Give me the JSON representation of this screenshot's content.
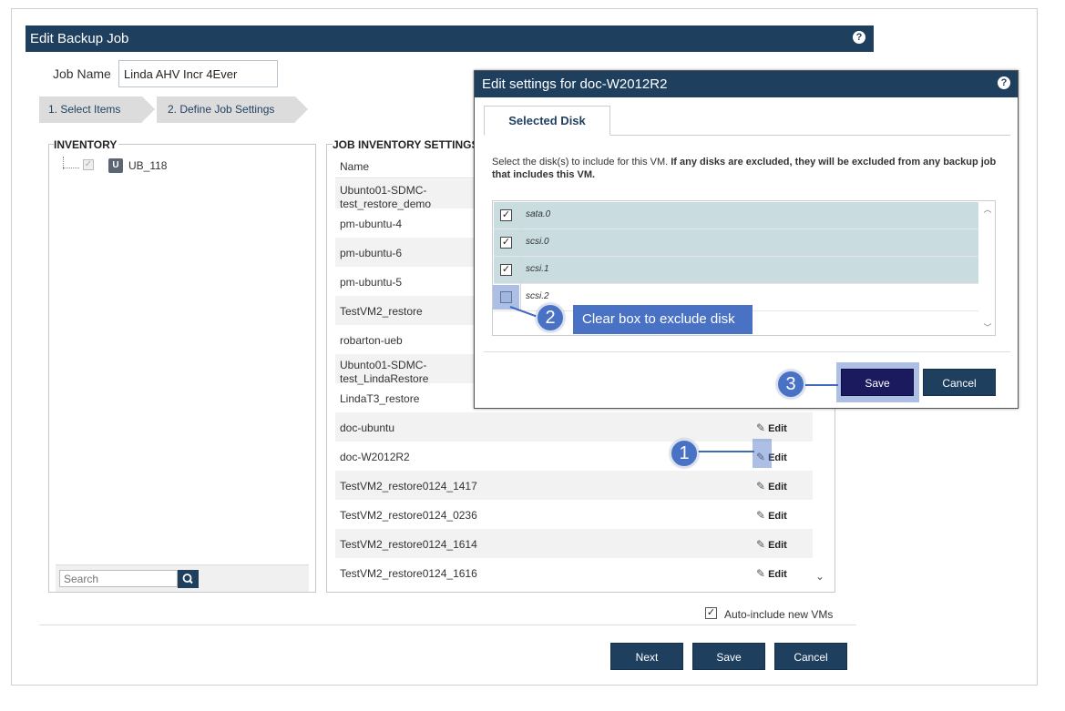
{
  "main": {
    "title": "Edit Backup Job",
    "job_name_label": "Job Name",
    "job_name_value": "Linda AHV Incr 4Ever",
    "steps": [
      {
        "label": "1. Select Items",
        "active": true
      },
      {
        "label": "2. Define Job Settings",
        "active": false
      }
    ],
    "inventory": {
      "title": "INVENTORY",
      "node_label": "UB_118",
      "node_icon": "vm-host-icon",
      "search_placeholder": "Search"
    },
    "job_inventory": {
      "title": "JOB INVENTORY SETTINGS",
      "column_name": "Name",
      "edit_label": "Edit",
      "rows": [
        {
          "name": "Ubunto01-SDMC-\ntest_restore_demo"
        },
        {
          "name": "pm-ubuntu-4"
        },
        {
          "name": "pm-ubuntu-6"
        },
        {
          "name": "pm-ubuntu-5"
        },
        {
          "name": "TestVM2_restore"
        },
        {
          "name": "robarton-ueb"
        },
        {
          "name": "Ubunto01-SDMC-\ntest_LindaRestore"
        },
        {
          "name": "LindaT3_restore"
        },
        {
          "name": "doc-ubuntu"
        },
        {
          "name": "doc-W2012R2"
        },
        {
          "name": "TestVM2_restore0124_1417"
        },
        {
          "name": "TestVM2_restore0124_0236"
        },
        {
          "name": "TestVM2_restore0124_1614"
        },
        {
          "name": "TestVM2_restore0124_1616"
        }
      ]
    },
    "auto_include_label": "Auto-include new VMs",
    "auto_include_checked": true,
    "buttons": {
      "next": "Next",
      "save": "Save",
      "cancel": "Cancel"
    }
  },
  "dialog": {
    "title": "Edit settings for doc-W2012R2",
    "tab_label": "Selected Disk",
    "description_plain": "Select the disk(s) to include for this VM. ",
    "description_bold": "If any disks are excluded, they will be excluded from any backup job that includes this VM.",
    "disks": [
      {
        "label": "sata.0",
        "checked": true
      },
      {
        "label": "scsi.0",
        "checked": true
      },
      {
        "label": "scsi.1",
        "checked": true
      },
      {
        "label": "scsi.2",
        "checked": false
      }
    ],
    "buttons": {
      "save": "Save",
      "cancel": "Cancel"
    }
  },
  "callouts": [
    {
      "number": "1"
    },
    {
      "number": "2",
      "label": "Clear box to exclude disk"
    },
    {
      "number": "3"
    }
  ],
  "colors": {
    "header_navy": "#1f3f5f",
    "callout_blue": "#4a72c4",
    "selected_row": "#c9dce0"
  }
}
